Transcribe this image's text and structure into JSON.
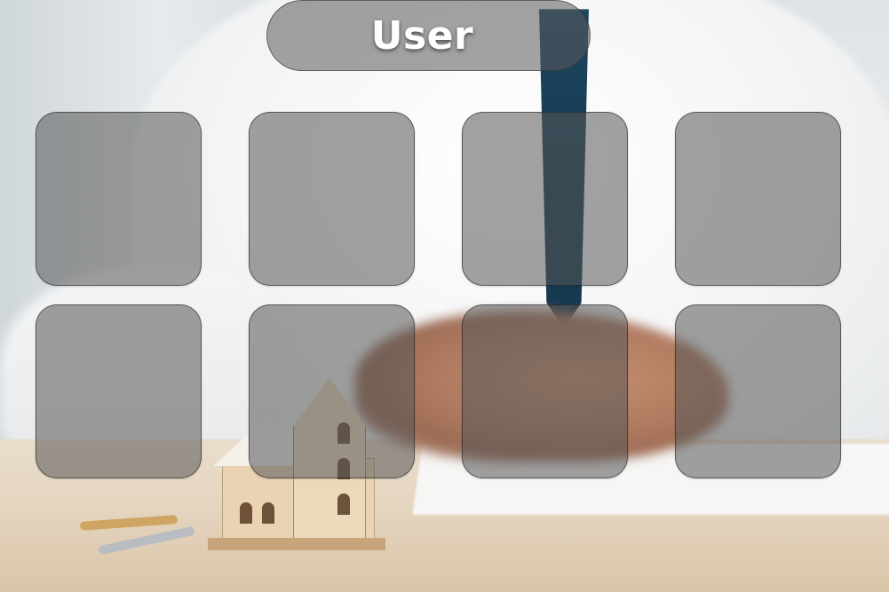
{
  "header": {
    "title": "User"
  },
  "tiles": [
    {
      "label": ""
    },
    {
      "label": ""
    },
    {
      "label": ""
    },
    {
      "label": ""
    },
    {
      "label": ""
    },
    {
      "label": ""
    },
    {
      "label": ""
    },
    {
      "label": ""
    }
  ],
  "colors": {
    "tile_fill": "#555555",
    "title_text": "#ffffff",
    "tie": "#163a52"
  }
}
